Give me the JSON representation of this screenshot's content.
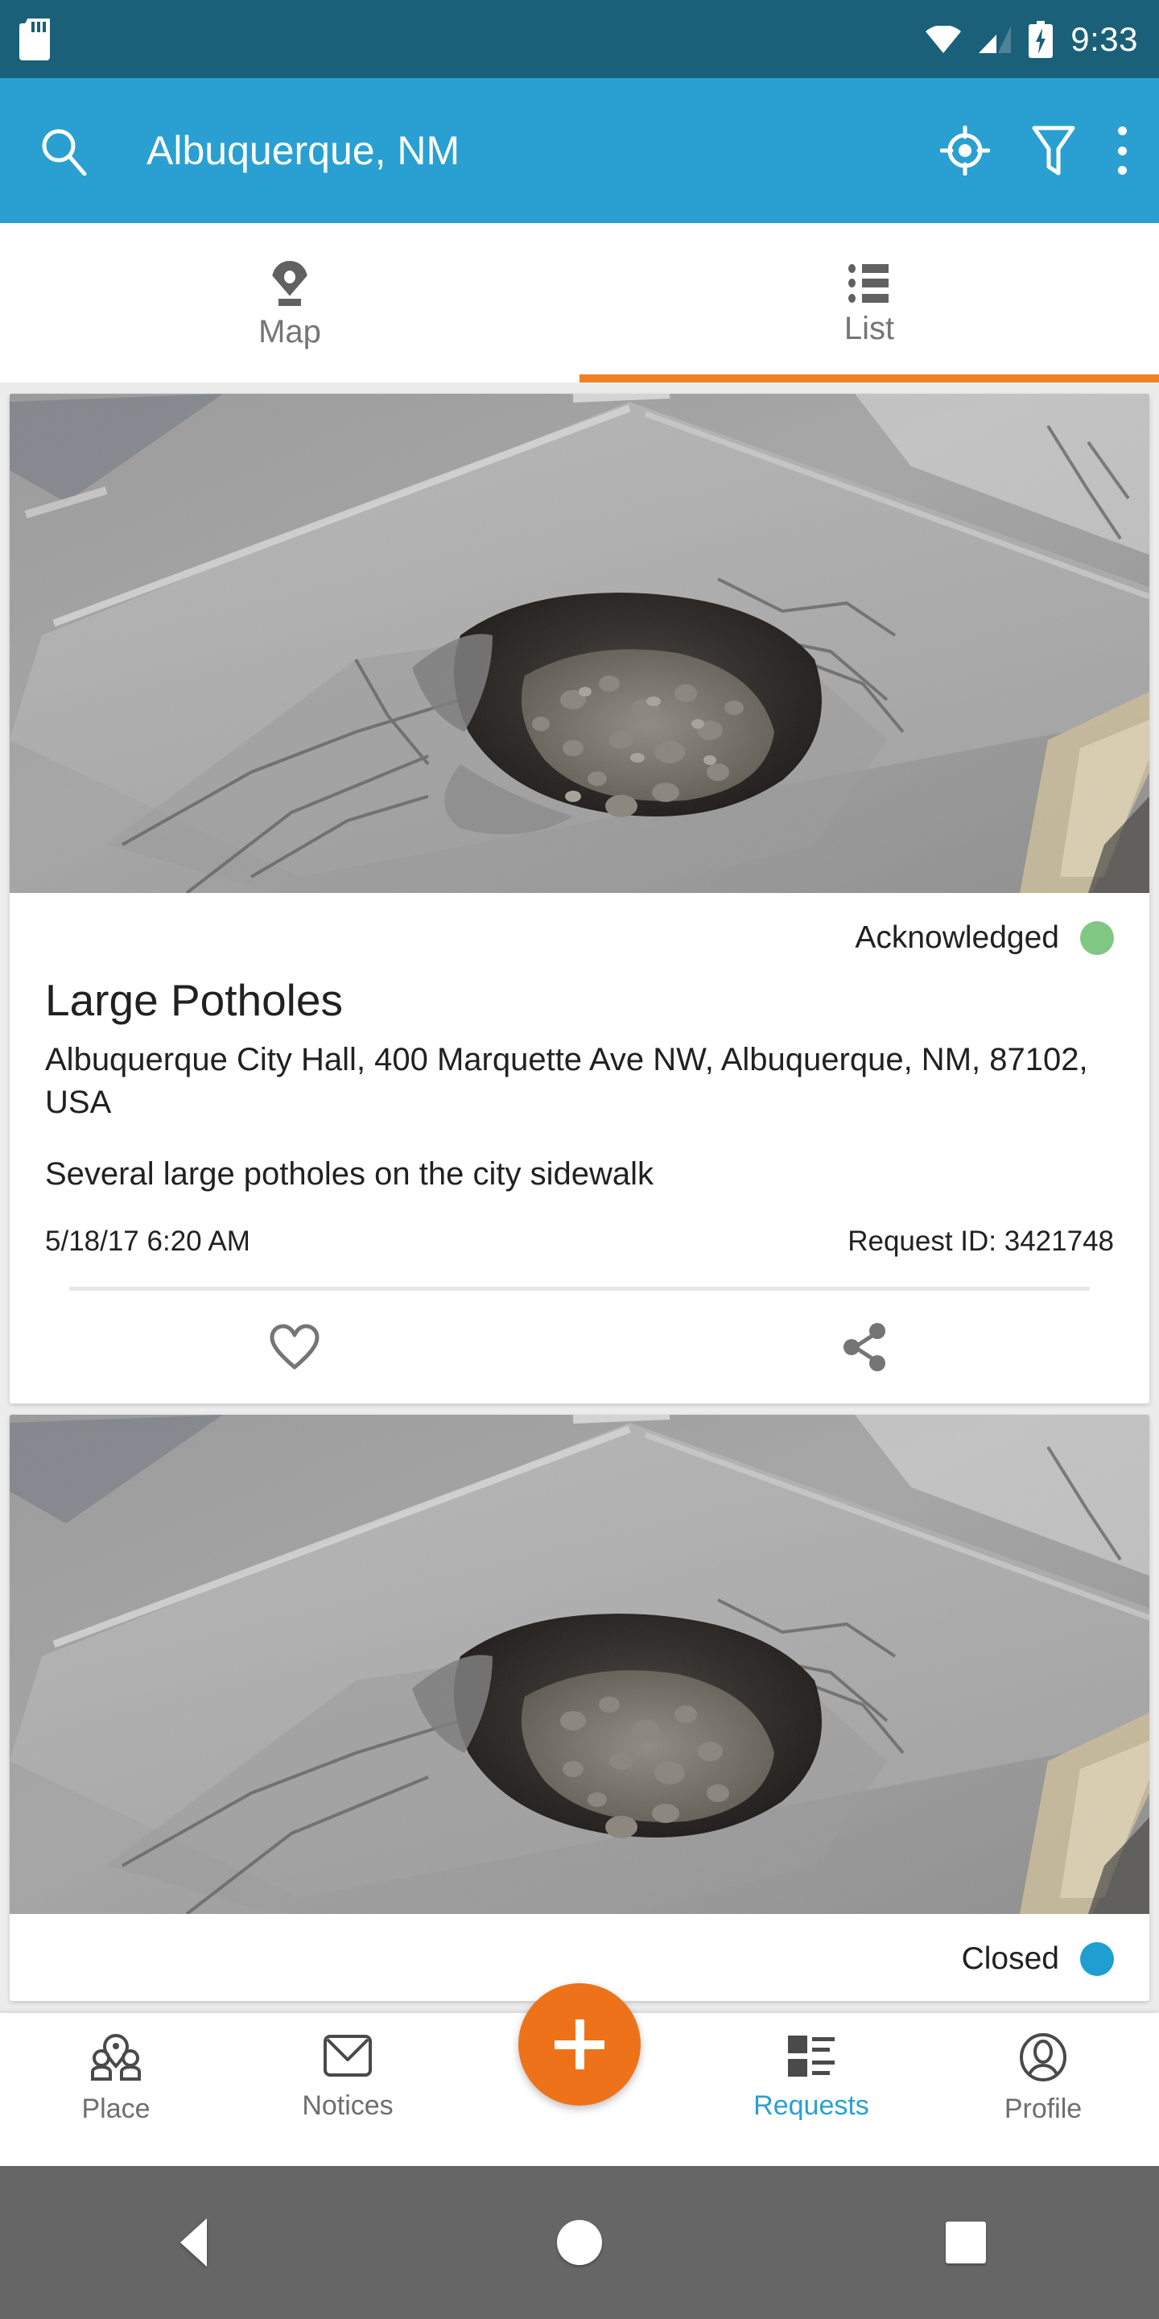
{
  "status_bar": {
    "time": "9:33",
    "icons": [
      "sd-card-icon",
      "wifi-icon",
      "cellular-signal-icon",
      "battery-charging-icon"
    ],
    "background_color": "#1B6079"
  },
  "app_bar": {
    "title": "Albuquerque, NM",
    "background_color": "#29A0D1",
    "search_icon": "search-icon",
    "locate_icon": "my-location-icon",
    "filter_icon": "filter-funnel-icon",
    "overflow_icon": "more-vertical-icon"
  },
  "tabs": {
    "indicator_color": "#F08123",
    "items": [
      {
        "label": "Map",
        "icon": "map-pin-icon",
        "active": false
      },
      {
        "label": "List",
        "icon": "list-icon",
        "active": true
      }
    ]
  },
  "requests": [
    {
      "status": "Acknowledged",
      "status_color": "#81C784",
      "title": "Large Potholes",
      "address": "Albuquerque City Hall, 400 Marquette Ave NW, Albuquerque, NM, 87102, USA",
      "description": "Several large potholes on the city sidewalk",
      "timestamp": "5/18/17 6:20 AM",
      "request_id": "Request ID: 3421748",
      "photo_alt": "pothole-photo",
      "favorite_icon": "heart-outline-icon",
      "share_icon": "share-icon"
    },
    {
      "status": "Closed",
      "status_color": "#1E9ED1",
      "photo_alt": "pothole-photo"
    }
  ],
  "bottom_nav": {
    "active_color": "#29A0D1",
    "fab": {
      "icon": "plus-icon",
      "color": "#EE7219"
    },
    "items": [
      {
        "label": "Place",
        "icon": "people-place-icon",
        "active": false
      },
      {
        "label": "Notices",
        "icon": "envelope-icon",
        "active": false
      },
      {
        "label": "Requests",
        "icon": "requests-list-icon",
        "active": true
      },
      {
        "label": "Profile",
        "icon": "person-circle-icon",
        "active": false
      }
    ]
  },
  "system_nav": {
    "back": "back-triangle-icon",
    "home": "home-circle-icon",
    "recents": "recents-square-icon"
  }
}
